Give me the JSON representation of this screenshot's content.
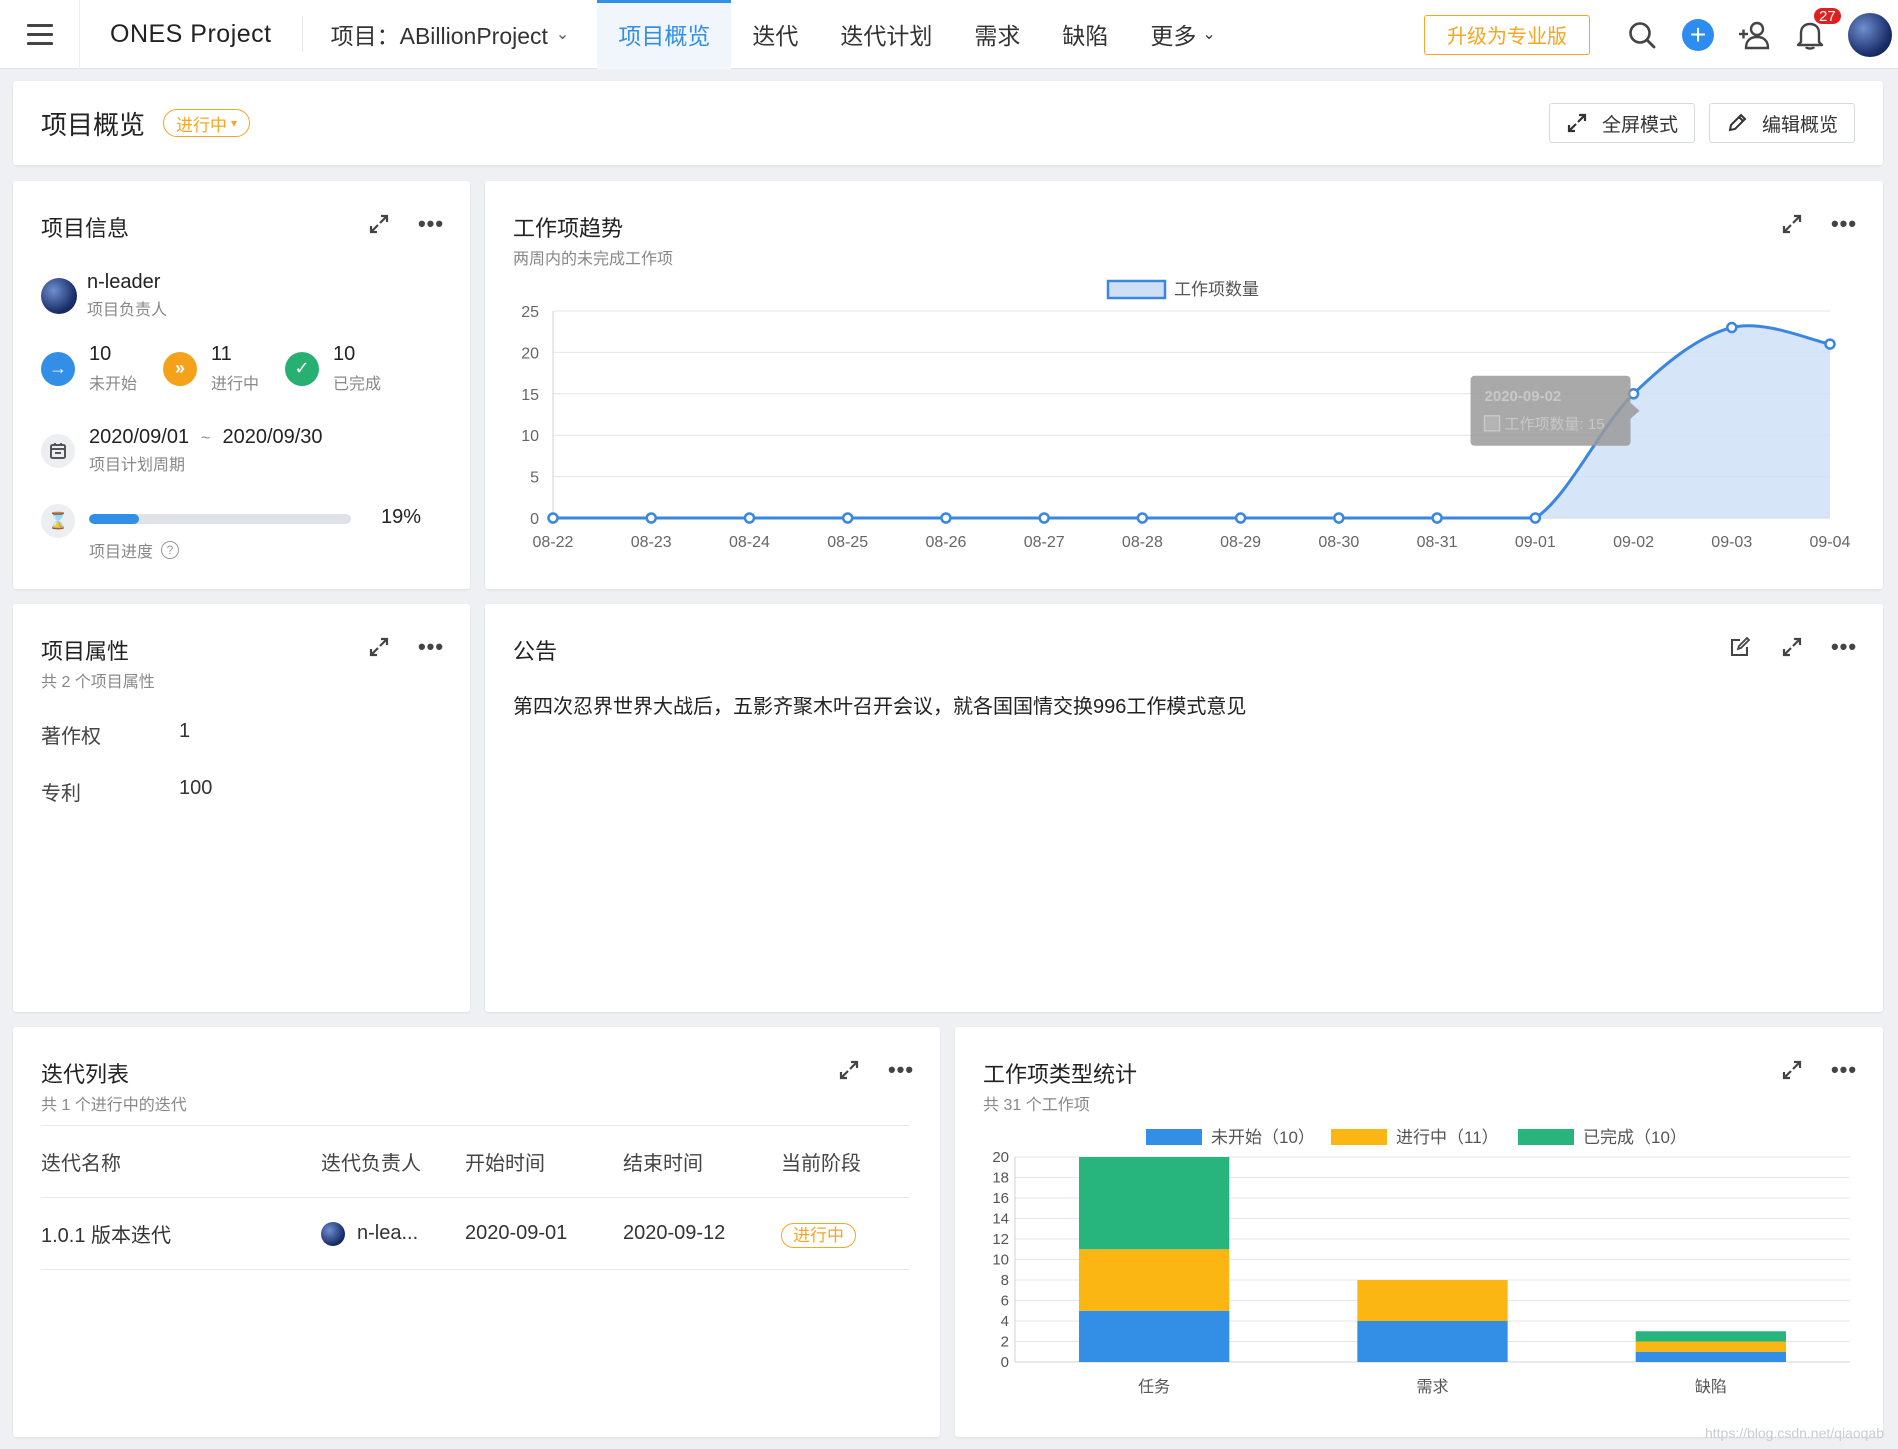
{
  "topbar": {
    "brand": "ONES Project",
    "project_switch": "项目：ABillionProject",
    "tabs": [
      {
        "label": "项目概览"
      },
      {
        "label": "迭代"
      },
      {
        "label": "迭代计划"
      },
      {
        "label": "需求"
      },
      {
        "label": "缺陷"
      },
      {
        "label": "更多"
      }
    ],
    "upgrade_label": "升级为专业版",
    "notification_count": "27"
  },
  "header": {
    "title": "项目概览",
    "status": "进行中",
    "fullscreen_label": "全屏模式",
    "edit_label": "编辑概览"
  },
  "project_info": {
    "title": "项目信息",
    "leader_name": "n-leader",
    "leader_role": "项目负责人",
    "stats": [
      {
        "value": "10",
        "label": "未开始",
        "color": "#338fe5"
      },
      {
        "value": "11",
        "label": "进行中",
        "color": "#f5a21b"
      },
      {
        "value": "10",
        "label": "已完成",
        "color": "#27b072"
      }
    ],
    "start_date": "2020/09/01",
    "tilde": "~",
    "end_date": "2020/09/30",
    "period_label": "项目计划周期",
    "progress_value": 0.19,
    "progress_text": "19%",
    "progress_label": "项目进度"
  },
  "trend": {
    "title": "工作项趋势",
    "subtitle": "两周内的未完成工作项",
    "tooltip_date": "2020-09-02",
    "tooltip_text": "工作项数量: 15"
  },
  "attributes": {
    "title": "项目属性",
    "subtitle": "共 2 个项目属性",
    "items": [
      {
        "key": "著作权",
        "value": "1"
      },
      {
        "key": "专利",
        "value": "100"
      }
    ]
  },
  "announcement": {
    "title": "公告",
    "text": "第四次忍界世界大战后，五影齐聚木叶召开会议，就各国国情交换996工作模式意见"
  },
  "iterations": {
    "title": "迭代列表",
    "subtitle": "共 1 个进行中的迭代",
    "columns": [
      "迭代名称",
      "迭代负责人",
      "开始时间",
      "结束时间",
      "当前阶段"
    ],
    "rows": [
      {
        "name": "1.0.1 版本迭代",
        "owner": "n-lea...",
        "start": "2020-09-01",
        "end": "2020-09-12",
        "stage": "进行中"
      }
    ]
  },
  "type_stats": {
    "title": "工作项类型统计",
    "subtitle": "共 31 个工作项"
  },
  "watermark": "https://blog.csdn.net/qiaoqab",
  "chart_data": [
    {
      "type": "area",
      "legend": [
        "工作项数量"
      ],
      "x": [
        "08-22",
        "08-23",
        "08-24",
        "08-25",
        "08-26",
        "08-27",
        "08-28",
        "08-29",
        "08-30",
        "08-31",
        "09-01",
        "09-02",
        "09-03",
        "09-04"
      ],
      "series": [
        {
          "name": "工作项数量",
          "values": [
            0,
            0,
            0,
            0,
            0,
            0,
            0,
            0,
            0,
            0,
            0,
            15,
            23,
            21
          ],
          "color": "#3a86e0"
        }
      ],
      "ylim": [
        0,
        25
      ],
      "yticks": [
        0,
        5,
        10,
        15,
        20,
        25
      ],
      "grid": true,
      "legend_position": "top-center"
    },
    {
      "type": "bar",
      "stacked": true,
      "categories": [
        "任务",
        "需求",
        "缺陷"
      ],
      "series": [
        {
          "name": "未开始（10）",
          "values": [
            5,
            4,
            1
          ],
          "color": "#338fe5"
        },
        {
          "name": "进行中（11）",
          "values": [
            6,
            4,
            1
          ],
          "color": "#fbb614"
        },
        {
          "name": "已完成（10）",
          "values": [
            9,
            0,
            1
          ],
          "color": "#27b57d"
        }
      ],
      "ylim": [
        0,
        20
      ],
      "yticks": [
        0,
        2,
        4,
        6,
        8,
        10,
        12,
        14,
        16,
        18,
        20
      ],
      "grid": true,
      "legend_position": "top-center"
    }
  ]
}
